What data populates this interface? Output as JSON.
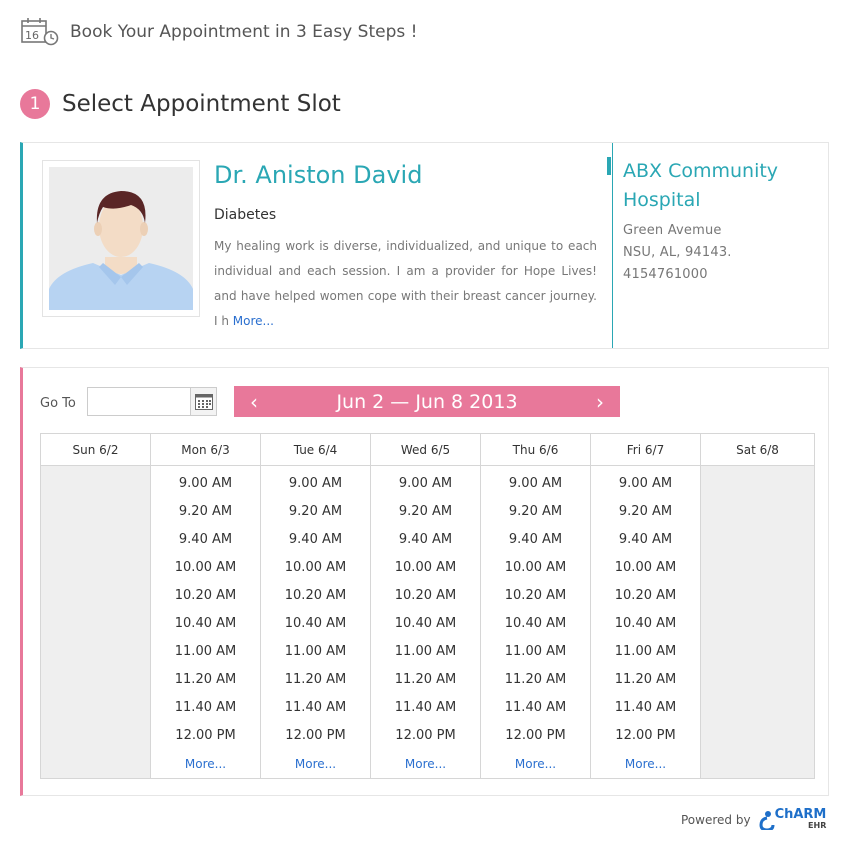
{
  "header": {
    "title": "Book Your Appointment in 3 Easy Steps !",
    "calendar_icon_day": "16"
  },
  "step": {
    "number": "1",
    "title": "Select Appointment Slot"
  },
  "doctor": {
    "name": "Dr. Aniston David",
    "specialty": "Diabetes",
    "bio": "My healing work is diverse, individualized, and unique to each individual and each session. I am a provider for Hope Lives! and have helped women cope with their breast cancer journey. I h",
    "more_link": "More..."
  },
  "hospital": {
    "name": "ABX Community Hospital",
    "address_line1": "Green Avemue",
    "address_line2": "NSU, AL, 94143.",
    "phone": "4154761000"
  },
  "schedule": {
    "goto_label": "Go To",
    "goto_value": "",
    "week_label": "Jun 2 — Jun 8 2013",
    "prev_arrow": "‹",
    "next_arrow": "›",
    "more_label": "More...",
    "days": [
      {
        "label": "Sun 6/2",
        "available": false,
        "slots": []
      },
      {
        "label": "Mon 6/3",
        "available": true,
        "slots": [
          "9.00 AM",
          "9.20 AM",
          "9.40 AM",
          "10.00 AM",
          "10.20 AM",
          "10.40 AM",
          "11.00 AM",
          "11.20 AM",
          "11.40 AM",
          "12.00 PM"
        ]
      },
      {
        "label": "Tue 6/4",
        "available": true,
        "slots": [
          "9.00 AM",
          "9.20 AM",
          "9.40 AM",
          "10.00 AM",
          "10.20 AM",
          "10.40 AM",
          "11.00 AM",
          "11.20 AM",
          "11.40 AM",
          "12.00 PM"
        ]
      },
      {
        "label": "Wed 6/5",
        "available": true,
        "slots": [
          "9.00 AM",
          "9.20 AM",
          "9.40 AM",
          "10.00 AM",
          "10.20 AM",
          "10.40 AM",
          "11.00 AM",
          "11.20 AM",
          "11.40 AM",
          "12.00 PM"
        ]
      },
      {
        "label": "Thu 6/6",
        "available": true,
        "slots": [
          "9.00 AM",
          "9.20 AM",
          "9.40 AM",
          "10.00 AM",
          "10.20 AM",
          "10.40 AM",
          "11.00 AM",
          "11.20 AM",
          "11.40 AM",
          "12.00 PM"
        ]
      },
      {
        "label": "Fri 6/7",
        "available": true,
        "slots": [
          "9.00 AM",
          "9.20 AM",
          "9.40 AM",
          "10.00 AM",
          "10.20 AM",
          "10.40 AM",
          "11.00 AM",
          "11.20 AM",
          "11.40 AM",
          "12.00 PM"
        ]
      },
      {
        "label": "Sat 6/8",
        "available": false,
        "slots": []
      }
    ]
  },
  "footer": {
    "powered_by": "Powered by",
    "logo_name": "ChARM",
    "logo_sub": "EHR"
  },
  "colors": {
    "accent_teal": "#2aa7b4",
    "accent_pink": "#e8789a",
    "link_blue": "#2a6fcf"
  },
  "icons": [
    "calendar-clock-icon",
    "calendar-icon",
    "chevron-left-icon",
    "chevron-right-icon",
    "charm-logo-icon"
  ]
}
